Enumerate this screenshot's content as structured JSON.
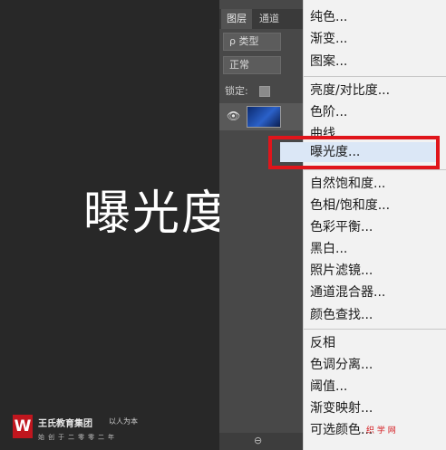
{
  "canvas": {
    "title": "曝光度"
  },
  "branding": {
    "logo_letter": "W",
    "name": "王氏教育集团",
    "slogan": "以人为本",
    "since": "始创于二零零二年"
  },
  "layers_panel": {
    "tabs": [
      "图层",
      "通道"
    ],
    "filter_value": "ρ 类型",
    "blend_mode": "正常",
    "lock_label": "锁定:"
  },
  "adjustment_menu": {
    "groups": [
      [
        "纯色...",
        "渐变...",
        "图案..."
      ],
      [
        "亮度/对比度...",
        "色阶...",
        "曲线...",
        "曝光度..."
      ],
      [
        "自然饱和度...",
        "色相/饱和度...",
        "色彩平衡...",
        "黑白...",
        "照片滤镜...",
        "通道混合器...",
        "颜色查找..."
      ],
      [
        "反相",
        "色调分离...",
        "阈值...",
        "渐变映射...",
        "可选颜色..."
      ]
    ],
    "highlighted": "曝光度..."
  },
  "watermark": "织 学 网",
  "colors": {
    "highlight_border": "#e0151b",
    "menu_bg": "#f2f2f2",
    "panel_bg": "#484848",
    "canvas_bg": "#282828"
  }
}
